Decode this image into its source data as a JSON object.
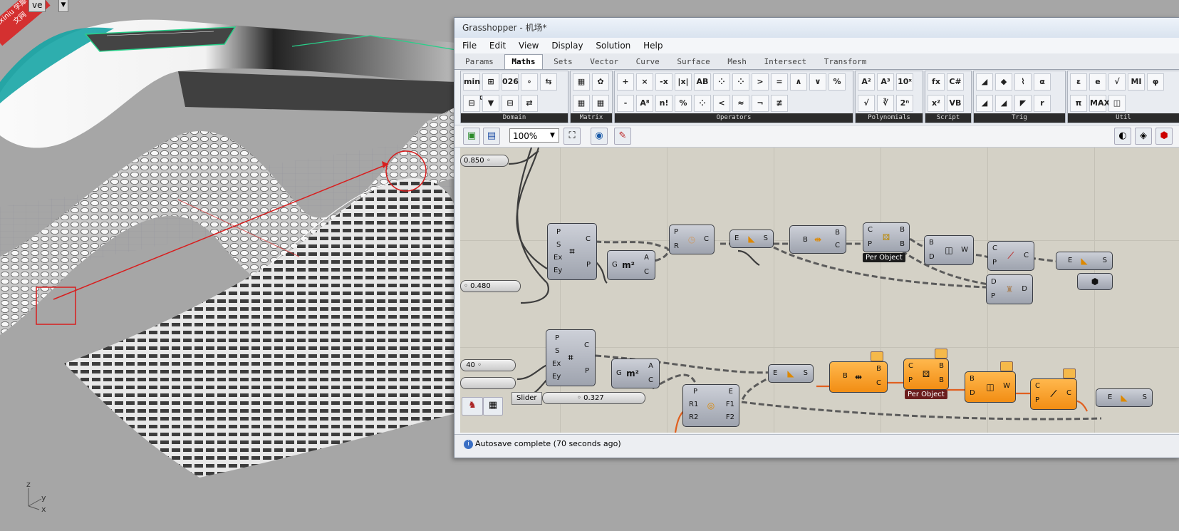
{
  "viewport": {
    "label_stub": "ve",
    "watermark": "xuexiniu 学犀牛中文网",
    "axes": {
      "z": "z",
      "y": "y",
      "x": "x"
    }
  },
  "grasshopper": {
    "title": "Grasshopper - 机场*",
    "menu": [
      "File",
      "Edit",
      "View",
      "Display",
      "Solution",
      "Help"
    ],
    "tabs": [
      "Params",
      "Maths",
      "Sets",
      "Vector",
      "Curve",
      "Surface",
      "Mesh",
      "Intersect",
      "Transform"
    ],
    "active_tab": "Maths",
    "ribbon_groups": [
      {
        "label": "Domain",
        "icons": [
          "min\nmax",
          "⊞",
          "026",
          "∘",
          "⇆",
          "⊟",
          "▼",
          "⊟",
          "⇄"
        ]
      },
      {
        "label": "Matrix",
        "icons": [
          "▦",
          "✿",
          "▦",
          "▦"
        ]
      },
      {
        "label": "Operators",
        "icons": [
          "+",
          "×",
          "-x",
          "|x|",
          "AB",
          "⁘",
          "⁘",
          ">",
          "=",
          "∧",
          "∨",
          "%",
          "-",
          "A⁸",
          "n!",
          "%",
          "⁘",
          "<",
          "≈",
          "¬",
          "≢"
        ]
      },
      {
        "label": "Polynomials",
        "icons": [
          "A²",
          "A³",
          "10ˣ",
          "√",
          "∛",
          "2ⁿ"
        ]
      },
      {
        "label": "Script",
        "icons": [
          "fx",
          "C#",
          "x²",
          "VB"
        ]
      },
      {
        "label": "Trig",
        "icons": [
          "◢",
          "◆",
          "⌇",
          "α",
          "◢",
          "◢",
          "◤",
          "r"
        ]
      },
      {
        "label": "Util",
        "icons": [
          "ε",
          "e",
          "√",
          "MI",
          "φ",
          "π",
          "MAX",
          "◫"
        ]
      }
    ],
    "toolbar": {
      "zoom": "100%"
    },
    "canvas": {
      "sliders": [
        {
          "name": "slider-top",
          "value": "0.850"
        },
        {
          "name": "slider-mid",
          "value": "0.480"
        },
        {
          "name": "slider-low",
          "value": "40"
        },
        {
          "name": "slider-bottom",
          "value": "0.327"
        }
      ],
      "slider_button": "Slider",
      "per_object": "Per Object",
      "components": [
        {
          "name": "surface-divide-1",
          "in": [
            "P",
            "S",
            "Ex",
            "Ey"
          ],
          "out": [
            "C",
            "P"
          ],
          "body": "⌗"
        },
        {
          "name": "area-1",
          "in": [
            "G"
          ],
          "out": [
            "A",
            "C"
          ],
          "body": "m²"
        },
        {
          "name": "evaluate-1",
          "in": [
            "P",
            "R"
          ],
          "out": [
            "C"
          ],
          "body": "◷"
        },
        {
          "name": "expression-1",
          "in": [
            "E"
          ],
          "out": [
            "S"
          ],
          "body": "◣"
        },
        {
          "name": "bounds-1",
          "in": [
            "B"
          ],
          "out": [
            "B",
            "C"
          ],
          "body": "⇹"
        },
        {
          "name": "random-1",
          "in": [
            "C",
            "P"
          ],
          "out": [
            "B",
            "B"
          ],
          "body": "⚄"
        },
        {
          "name": "box-1",
          "in": [
            "B",
            "D"
          ],
          "out": [
            "W"
          ],
          "body": "◫"
        },
        {
          "name": "vector-1",
          "in": [
            "C",
            "P"
          ],
          "out": [
            "C"
          ],
          "body": "⟋"
        },
        {
          "name": "expression-2",
          "in": [
            "E"
          ],
          "out": [
            "S"
          ],
          "body": "◣"
        },
        {
          "name": "deconstruct-1",
          "in": [
            "D",
            "P"
          ],
          "out": [
            "D"
          ],
          "body": "♜"
        },
        {
          "name": "surface-divide-2",
          "in": [
            "P",
            "S",
            "Ex",
            "Ey"
          ],
          "out": [
            "C",
            "P"
          ],
          "body": "⌗"
        },
        {
          "name": "area-2",
          "in": [
            "G"
          ],
          "out": [
            "A",
            "C"
          ],
          "body": "m²"
        },
        {
          "name": "expression-3",
          "in": [
            "E"
          ],
          "out": [
            "S"
          ],
          "body": "◣"
        },
        {
          "name": "bounds-2",
          "in": [
            "B"
          ],
          "out": [
            "B",
            "C"
          ],
          "body": "⇹"
        },
        {
          "name": "random-2",
          "in": [
            "C",
            "P"
          ],
          "out": [
            "B",
            "B"
          ],
          "body": "⚄"
        },
        {
          "name": "box-2",
          "in": [
            "B",
            "D"
          ],
          "out": [
            "W"
          ],
          "body": "◫"
        },
        {
          "name": "vector-2",
          "in": [
            "C",
            "P"
          ],
          "out": [
            "C"
          ],
          "body": "⟋"
        },
        {
          "name": "ellipse-1",
          "in": [
            "P",
            "R1",
            "R2"
          ],
          "out": [
            "E",
            "F1",
            "F2"
          ],
          "body": "◎"
        },
        {
          "name": "expression-4",
          "in": [
            "E"
          ],
          "out": [
            "S"
          ],
          "body": "◣"
        }
      ]
    },
    "status": "Autosave complete (70 seconds ago)"
  }
}
